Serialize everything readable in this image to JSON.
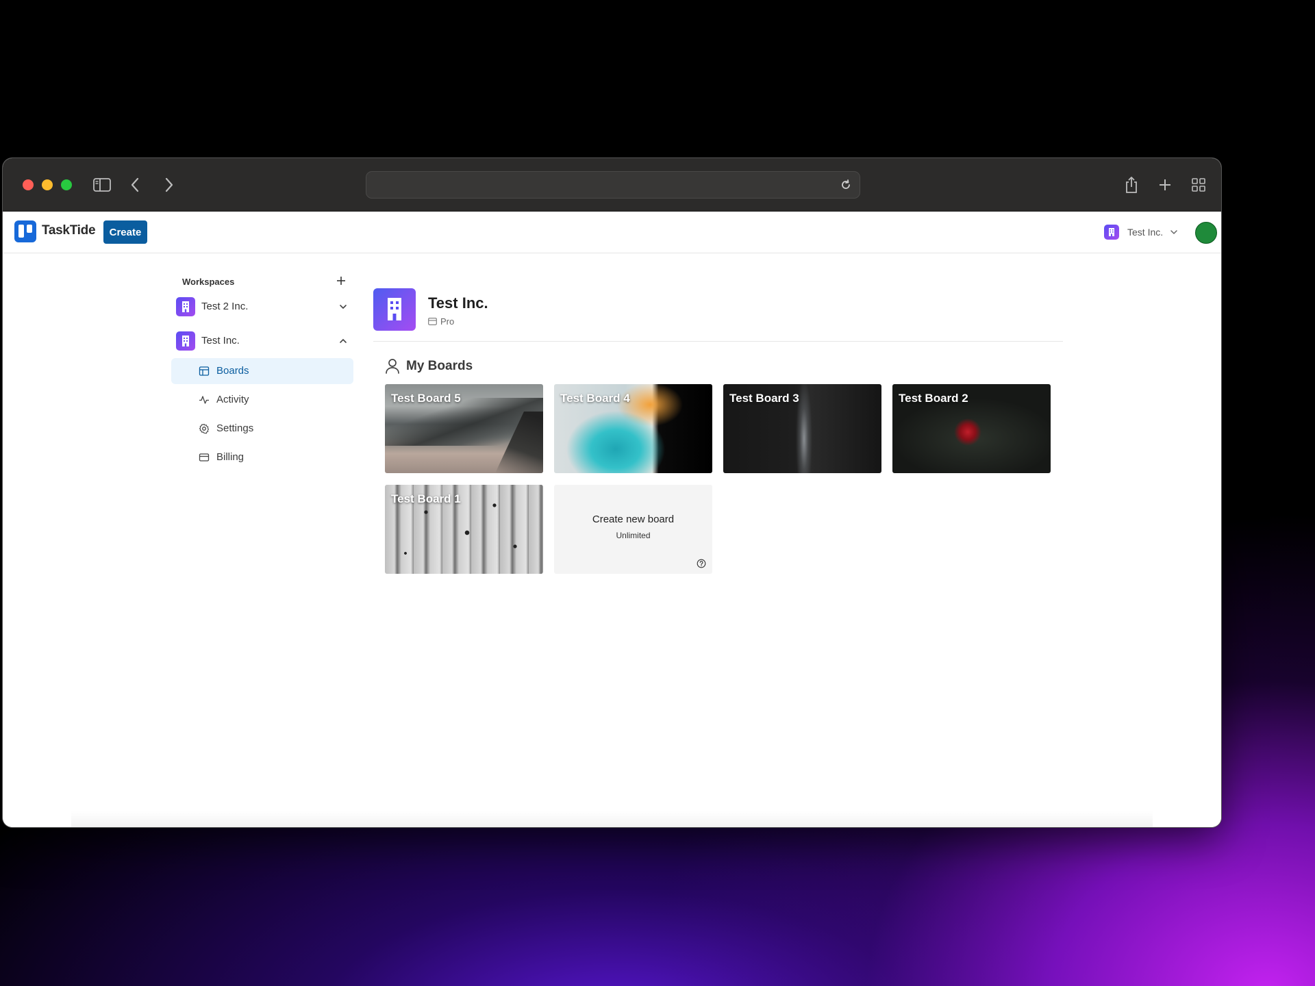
{
  "browser": {
    "url": ""
  },
  "app": {
    "name": "TaskTide",
    "create_label": "Create",
    "current_workspace": "Test Inc."
  },
  "sidebar": {
    "heading": "Workspaces",
    "workspaces": [
      {
        "name": "Test 2 Inc.",
        "expanded": false
      },
      {
        "name": "Test Inc.",
        "expanded": true
      }
    ],
    "nav": [
      {
        "label": "Boards",
        "icon": "board-icon",
        "active": true
      },
      {
        "label": "Activity",
        "icon": "activity-icon",
        "active": false
      },
      {
        "label": "Settings",
        "icon": "gear-icon",
        "active": false
      },
      {
        "label": "Billing",
        "icon": "credit-card-icon",
        "active": false
      }
    ]
  },
  "main": {
    "org_name": "Test Inc.",
    "plan": "Pro",
    "section_title": "My Boards",
    "boards": [
      {
        "title": "Test Board 5"
      },
      {
        "title": "Test Board 4"
      },
      {
        "title": "Test Board 3"
      },
      {
        "title": "Test Board 2"
      },
      {
        "title": "Test Board 1"
      }
    ],
    "create_card": {
      "title": "Create new board",
      "subtitle": "Unlimited"
    }
  },
  "colors": {
    "brand": "#1769d9",
    "create_button": "#0b5d9f",
    "active_nav_bg": "#e9f4fd",
    "workspace_badge": "#7a4ff0"
  }
}
